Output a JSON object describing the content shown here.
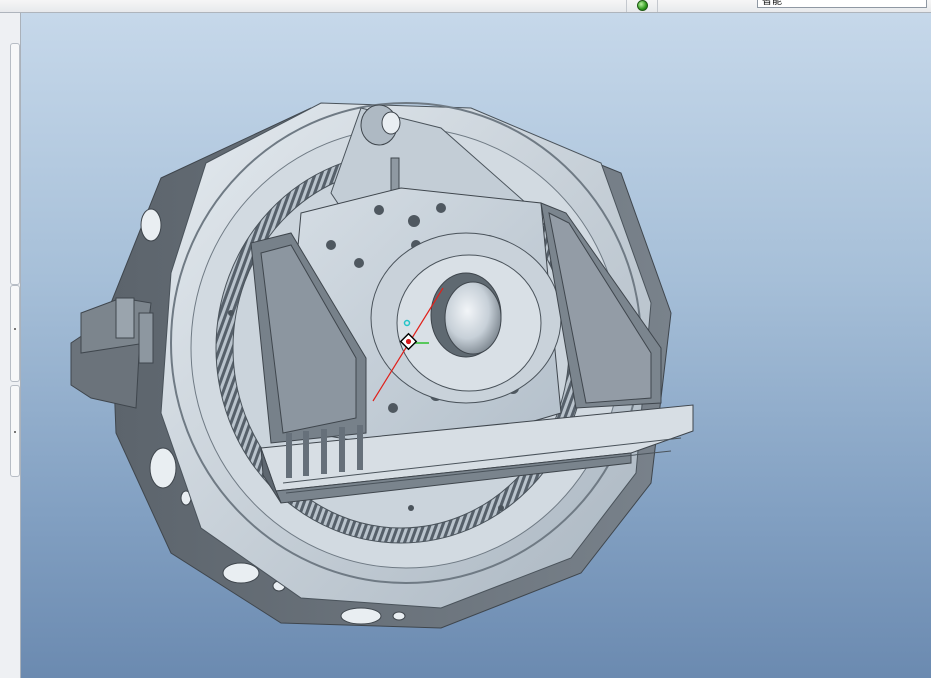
{
  "toolbar": {
    "filter_value": "智能",
    "status_color": "#2f9b1d"
  },
  "viewport": {
    "background_top": "#c6d8ea",
    "background_bottom": "#6b8ab0",
    "model_color": "#c9d3dc"
  },
  "icons": {
    "status": "green-circle",
    "model_origin": "diamond-origin-marker"
  }
}
